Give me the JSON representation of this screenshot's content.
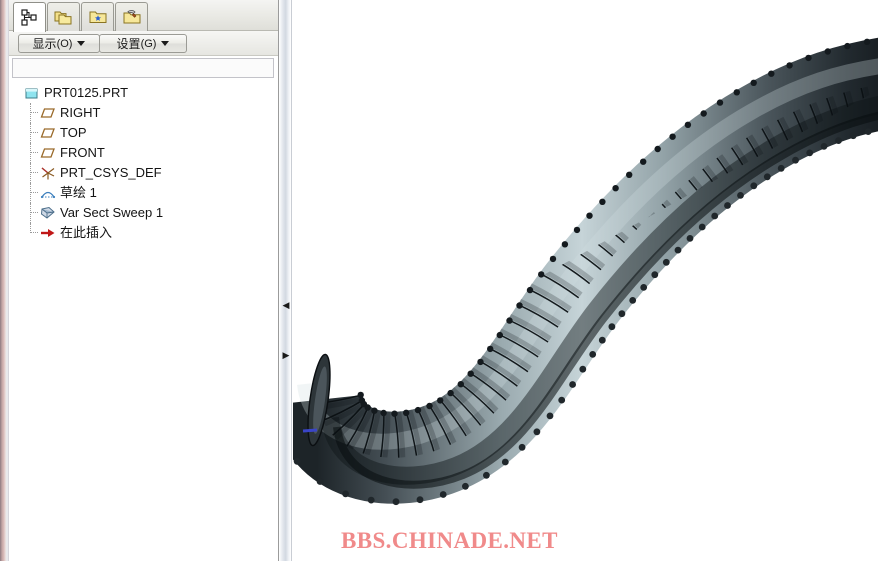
{
  "window": {
    "background": "#ffffff"
  },
  "sidebar": {
    "tabs": [
      {
        "name": "model-tree-tab",
        "icon": "model-tree-icon",
        "title": "模型树",
        "active": true
      },
      {
        "name": "layer-tree-tab",
        "icon": "folders-icon",
        "title": "层",
        "active": false
      },
      {
        "name": "favorites-folder-tab",
        "icon": "folder-star-icon",
        "title": "收藏夹",
        "active": false
      },
      {
        "name": "tools-folder-tab",
        "icon": "folder-hammer-icon",
        "title": "工具",
        "active": false
      }
    ],
    "toolbar": {
      "show_label": "显示",
      "show_mnemonic": "(O)",
      "settings_label": "设置",
      "settings_mnemonic": "(G)"
    },
    "filter_value": "",
    "tree": {
      "root": {
        "label": "PRT0125.PRT",
        "icon": "part-icon"
      },
      "items": [
        {
          "label": "RIGHT",
          "icon": "datum-plane-icon"
        },
        {
          "label": "TOP",
          "icon": "datum-plane-icon"
        },
        {
          "label": "FRONT",
          "icon": "datum-plane-icon"
        },
        {
          "label": "PRT_CSYS_DEF",
          "icon": "coordinate-system-icon"
        },
        {
          "label": "草绘 1",
          "icon": "sketch-icon"
        },
        {
          "label": "Var Sect Sweep 1",
          "icon": "swept-feature-icon"
        },
        {
          "label": "在此插入",
          "icon": "insert-here-arrow-icon"
        }
      ]
    }
  },
  "splitter": {
    "collapse_left_icon": "chevron-left-icon",
    "collapse_right_icon": "chevron-right-icon"
  },
  "viewport": {
    "model_name": "Var Sect Sweep 1",
    "shading": "shaded-metallic",
    "colors": {
      "highlight": "#cfdde0",
      "midtone": "#6f7d82",
      "shadow": "#232a2e",
      "edge": "#0c1012",
      "background": "#ffffff",
      "end_marker": "#3a45c8"
    },
    "rib_count": 42
  },
  "watermark": {
    "text": "BBS.CHINADE.NET",
    "color": "#f08a8a"
  }
}
